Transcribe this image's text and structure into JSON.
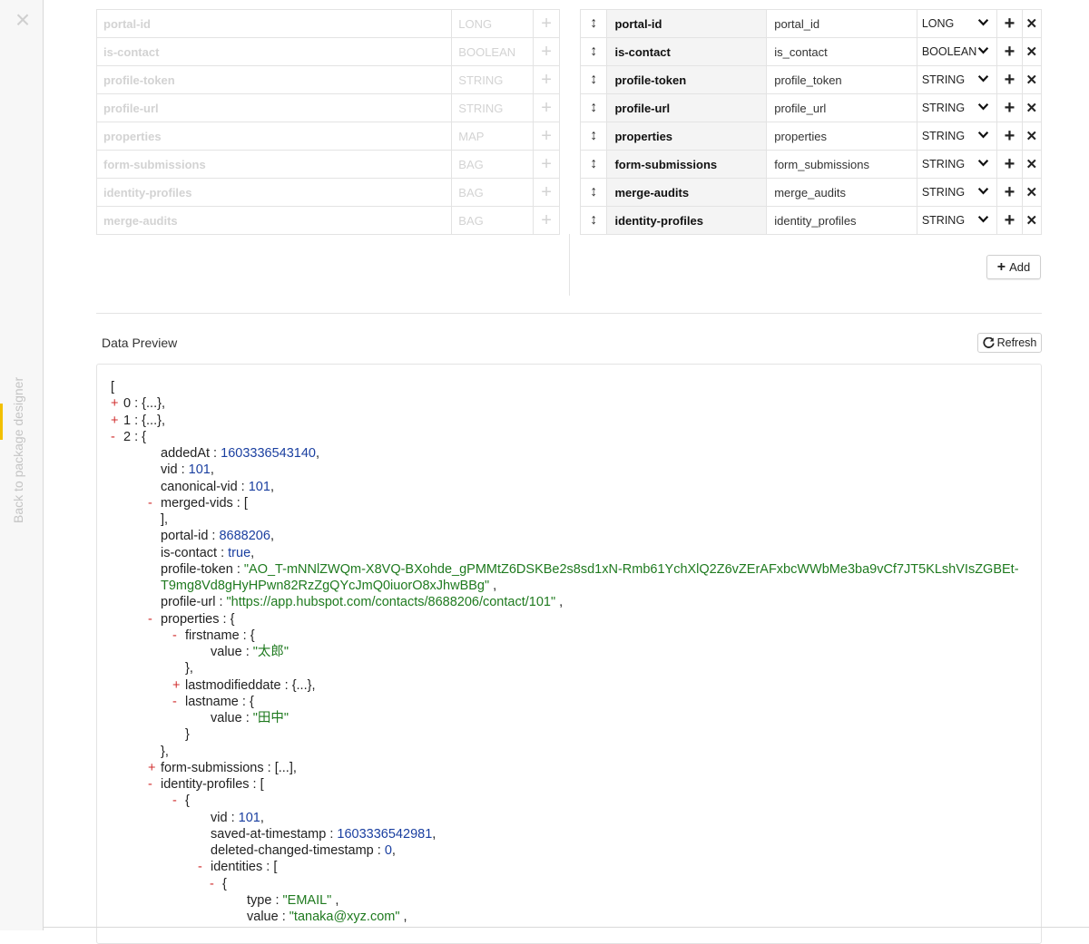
{
  "rail": {
    "close_icon": "close-icon",
    "back_label": "Back to package designer"
  },
  "source_fields": [
    {
      "name": "portal-id",
      "type": "LONG"
    },
    {
      "name": "is-contact",
      "type": "BOOLEAN"
    },
    {
      "name": "profile-token",
      "type": "STRING"
    },
    {
      "name": "profile-url",
      "type": "STRING"
    },
    {
      "name": "properties",
      "type": "MAP"
    },
    {
      "name": "form-submissions",
      "type": "BAG"
    },
    {
      "name": "identity-profiles",
      "type": "BAG"
    },
    {
      "name": "merge-audits",
      "type": "BAG"
    }
  ],
  "mapped_fields": [
    {
      "name": "portal-id",
      "alias": "portal_id",
      "type": "LONG"
    },
    {
      "name": "is-contact",
      "alias": "is_contact",
      "type": "BOOLEAN"
    },
    {
      "name": "profile-token",
      "alias": "profile_token",
      "type": "STRING"
    },
    {
      "name": "profile-url",
      "alias": "profile_url",
      "type": "STRING"
    },
    {
      "name": "properties",
      "alias": "properties",
      "type": "STRING"
    },
    {
      "name": "form-submissions",
      "alias": "form_submissions",
      "type": "STRING"
    },
    {
      "name": "merge-audits",
      "alias": "merge_audits",
      "type": "STRING"
    },
    {
      "name": "identity-profiles",
      "alias": "identity_profiles",
      "type": "STRING"
    }
  ],
  "add_button": {
    "label": "Add"
  },
  "preview": {
    "title": "Data Preview",
    "refresh_label": "Refresh",
    "lines": [
      {
        "indent": 0,
        "toggle": "",
        "key": "",
        "value": "[",
        "vtype": ""
      },
      {
        "indent": 1,
        "toggle": "+",
        "key": "0",
        "value": "{...},",
        "vtype": ""
      },
      {
        "indent": 1,
        "toggle": "+",
        "key": "1",
        "value": "{...},",
        "vtype": ""
      },
      {
        "indent": 1,
        "toggle": "-",
        "key": "2",
        "value": "{",
        "vtype": ""
      },
      {
        "indent": 2,
        "toggle": "",
        "key": "addedAt",
        "value": "1603336543140",
        "vtype": "num",
        "suffix": ","
      },
      {
        "indent": 2,
        "toggle": "",
        "key": "vid",
        "value": "101",
        "vtype": "num",
        "suffix": ","
      },
      {
        "indent": 2,
        "toggle": "",
        "key": "canonical-vid",
        "value": "101",
        "vtype": "num",
        "suffix": ","
      },
      {
        "indent": 2,
        "toggle": "-",
        "key": "merged-vids",
        "value": "[",
        "vtype": ""
      },
      {
        "indent": 2,
        "toggle": "",
        "key": "",
        "value": "],",
        "vtype": ""
      },
      {
        "indent": 2,
        "toggle": "",
        "key": "portal-id",
        "value": "8688206",
        "vtype": "num",
        "suffix": ","
      },
      {
        "indent": 2,
        "toggle": "",
        "key": "is-contact",
        "value": "true",
        "vtype": "bool",
        "suffix": ","
      },
      {
        "indent": 2,
        "toggle": "",
        "key": "profile-token",
        "value": "\"AO_T-mNNlZWQm-X8VQ-BXohde_gPMMtZ6DSKBe2s8sd1xN-Rmb61YchXlQ2Z6vZErAFxbcWWbMe3ba9vCf7JT5KLshVIsZGBEt-",
        "vtype": "str",
        "suffix": ""
      },
      {
        "indent": 2,
        "toggle": "",
        "key": "",
        "value": "T9mg8Vd8gHyHPwn82RzZgQYcJmQ0iuorO8xJhwBBg\"",
        "vtype": "str",
        "suffix": " ,"
      },
      {
        "indent": 2,
        "toggle": "",
        "key": "profile-url",
        "value": "\"https://app.hubspot.com/contacts/8688206/contact/101\"",
        "vtype": "str",
        "suffix": " ,"
      },
      {
        "indent": 2,
        "toggle": "-",
        "key": "properties",
        "value": "{",
        "vtype": ""
      },
      {
        "indent": 3,
        "toggle": "-",
        "key": "firstname",
        "value": "{",
        "vtype": ""
      },
      {
        "indent": 4,
        "toggle": "",
        "key": "value",
        "value": "\"太郎\"",
        "vtype": "str",
        "suffix": ""
      },
      {
        "indent": 3,
        "toggle": "",
        "key": "",
        "value": "},",
        "vtype": ""
      },
      {
        "indent": 3,
        "toggle": "+",
        "key": "lastmodifieddate",
        "value": "{...},",
        "vtype": ""
      },
      {
        "indent": 3,
        "toggle": "-",
        "key": "lastname",
        "value": "{",
        "vtype": ""
      },
      {
        "indent": 4,
        "toggle": "",
        "key": "value",
        "value": "\"田中\"",
        "vtype": "str",
        "suffix": ""
      },
      {
        "indent": 3,
        "toggle": "",
        "key": "",
        "value": "}",
        "vtype": ""
      },
      {
        "indent": 2,
        "toggle": "",
        "key": "",
        "value": "},",
        "vtype": ""
      },
      {
        "indent": 2,
        "toggle": "+",
        "key": "form-submissions",
        "value": "[...],",
        "vtype": ""
      },
      {
        "indent": 2,
        "toggle": "-",
        "key": "identity-profiles",
        "value": "[",
        "vtype": ""
      },
      {
        "indent": 3,
        "toggle": "-",
        "key": "",
        "value": "{",
        "vtype": ""
      },
      {
        "indent": 4,
        "toggle": "",
        "key": "vid",
        "value": "101",
        "vtype": "num",
        "suffix": ","
      },
      {
        "indent": 4,
        "toggle": "",
        "key": "saved-at-timestamp",
        "value": "1603336542981",
        "vtype": "num",
        "suffix": ","
      },
      {
        "indent": 4,
        "toggle": "",
        "key": "deleted-changed-timestamp",
        "value": "0",
        "vtype": "num",
        "suffix": ","
      },
      {
        "indent": 4,
        "toggle": "-",
        "key": "identities",
        "value": "[",
        "vtype": ""
      },
      {
        "indent": 5,
        "toggle": "-",
        "key": "",
        "value": "{",
        "vtype": ""
      },
      {
        "indent": 6,
        "toggle": "",
        "key": "type",
        "value": "\"EMAIL\"",
        "vtype": "str",
        "suffix": " ,"
      },
      {
        "indent": 6,
        "toggle": "",
        "key": "value",
        "value": "\"tanaka@xyz.com\"",
        "vtype": "str",
        "suffix": " ,"
      }
    ]
  }
}
